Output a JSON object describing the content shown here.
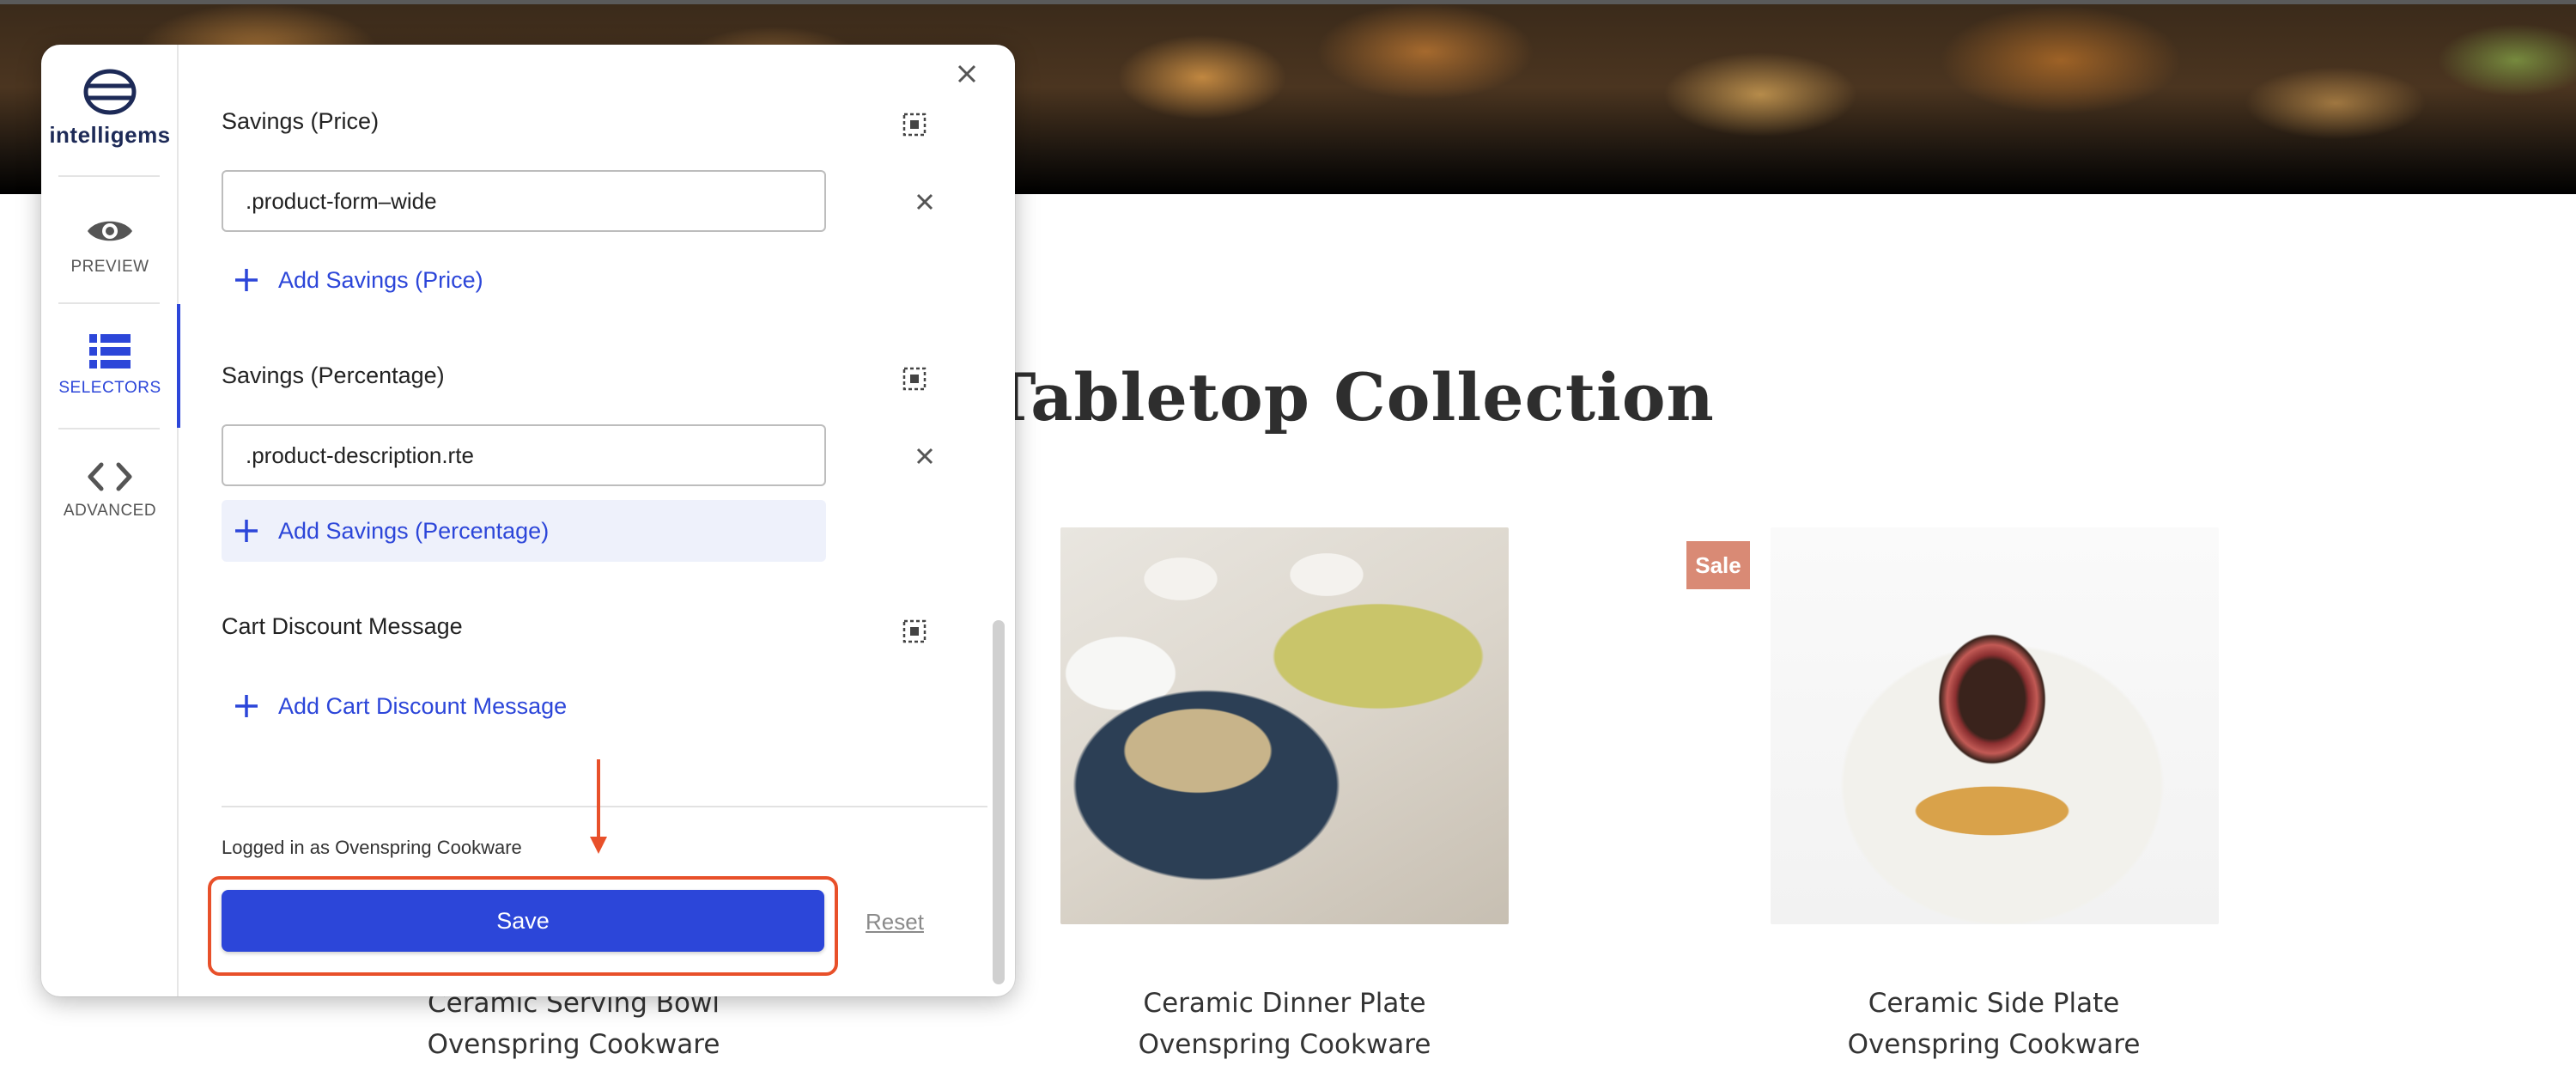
{
  "panel": {
    "brand": {
      "name": "intelligems"
    },
    "nav": [
      {
        "id": "preview",
        "label": "PREVIEW",
        "icon": "eye-icon"
      },
      {
        "id": "selectors",
        "label": "SELECTORS",
        "icon": "list-icon",
        "active": true
      },
      {
        "id": "advanced",
        "label": "ADVANCED",
        "icon": "code-icon"
      }
    ],
    "sections": [
      {
        "title": "Savings (Price)",
        "value": ".product-form–wide",
        "add_label": "Add Savings (Price)"
      },
      {
        "title": "Savings (Percentage)",
        "value": ".product-description.rte",
        "add_label": "Add Savings (Percentage)"
      },
      {
        "title": "Cart Discount Message",
        "add_label": "Add Cart Discount Message"
      }
    ],
    "footer": {
      "logged_in": "Logged in as Ovenspring Cookware",
      "save_label": "Save",
      "reset_label": "Reset"
    }
  },
  "store": {
    "collection_title": "Tabletop Collection",
    "products": [
      {
        "name": "Ceramic Serving Bowl",
        "vendor": "Ovenspring Cookware"
      },
      {
        "name": "Ceramic Dinner Plate",
        "vendor": "Ovenspring Cookware"
      },
      {
        "name": "Ceramic Side Plate",
        "vendor": "Ovenspring Cookware",
        "badge": "Sale"
      }
    ]
  },
  "colors": {
    "accent": "#2c46d9",
    "highlight": "#e8502a",
    "sale": "#d98a75"
  }
}
